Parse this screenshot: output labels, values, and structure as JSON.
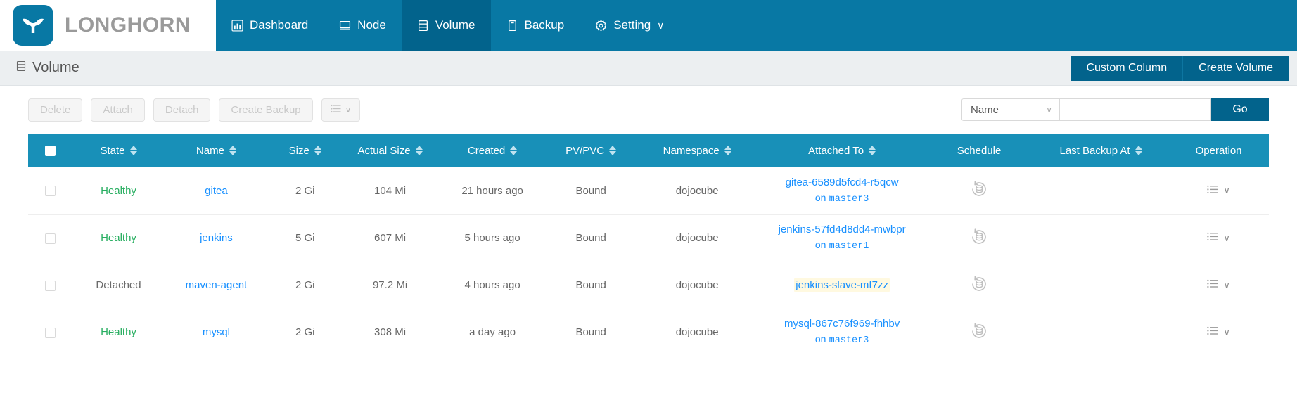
{
  "brand": {
    "name": "LONGHORN",
    "logo_icon": "longhorn-bull-logo"
  },
  "nav": {
    "items": [
      {
        "label": "Dashboard",
        "icon": "chart-bar-icon",
        "active": false
      },
      {
        "label": "Node",
        "icon": "server-node-icon",
        "active": false
      },
      {
        "label": "Volume",
        "icon": "volume-stack-icon",
        "active": true
      },
      {
        "label": "Backup",
        "icon": "backup-archive-icon",
        "active": false
      },
      {
        "label": "Setting",
        "icon": "gear-icon",
        "active": false,
        "caret": "∨"
      }
    ]
  },
  "page": {
    "title": "Volume",
    "title_icon": "volume-stack-icon",
    "actions": [
      {
        "label": "Custom Column"
      },
      {
        "label": "Create Volume"
      }
    ]
  },
  "toolbar": {
    "buttons": [
      {
        "label": "Delete",
        "disabled": true
      },
      {
        "label": "Attach",
        "disabled": true
      },
      {
        "label": "Detach",
        "disabled": true
      },
      {
        "label": "Create Backup",
        "disabled": true
      }
    ],
    "more_button": {
      "icon": "list-bullet-icon",
      "caret": "∨",
      "disabled": true
    },
    "search": {
      "filter_field": "Name",
      "filter_caret": "∨",
      "value": "",
      "placeholder": "",
      "go_label": "Go"
    }
  },
  "table": {
    "columns": [
      {
        "key": "checkbox",
        "label": "",
        "sortable": false
      },
      {
        "key": "state",
        "label": "State",
        "sortable": true
      },
      {
        "key": "name",
        "label": "Name",
        "sortable": true
      },
      {
        "key": "size",
        "label": "Size",
        "sortable": true
      },
      {
        "key": "actual_size",
        "label": "Actual Size",
        "sortable": true
      },
      {
        "key": "created",
        "label": "Created",
        "sortable": true
      },
      {
        "key": "pvpvc",
        "label": "PV/PVC",
        "sortable": true
      },
      {
        "key": "namespace",
        "label": "Namespace",
        "sortable": true
      },
      {
        "key": "attached_to",
        "label": "Attached To",
        "sortable": true
      },
      {
        "key": "schedule",
        "label": "Schedule",
        "sortable": false
      },
      {
        "key": "last_backup_at",
        "label": "Last Backup At",
        "sortable": true
      },
      {
        "key": "operation",
        "label": "Operation",
        "sortable": false
      }
    ],
    "rows": [
      {
        "state": "Healthy",
        "state_kind": "healthy",
        "name": "gitea",
        "size": "2 Gi",
        "actual_size": "104 Mi",
        "created": "21 hours ago",
        "pvpvc": "Bound",
        "namespace": "dojocube",
        "attached_pod": "gitea-6589d5fcd4-r5qcw",
        "attached_on": "on",
        "attached_node": "master3",
        "attached_highlight": false,
        "schedule_icon": "backup-schedule-icon",
        "last_backup_at": "",
        "operation_icon": "list-bullet-icon",
        "operation_caret": "∨"
      },
      {
        "state": "Healthy",
        "state_kind": "healthy",
        "name": "jenkins",
        "size": "5 Gi",
        "actual_size": "607 Mi",
        "created": "5 hours ago",
        "pvpvc": "Bound",
        "namespace": "dojocube",
        "attached_pod": "jenkins-57fd4d8dd4-mwbpr",
        "attached_on": "on",
        "attached_node": "master1",
        "attached_highlight": false,
        "schedule_icon": "backup-schedule-icon",
        "last_backup_at": "",
        "operation_icon": "list-bullet-icon",
        "operation_caret": "∨"
      },
      {
        "state": "Detached",
        "state_kind": "detached",
        "name": "maven-agent",
        "size": "2 Gi",
        "actual_size": "97.2 Mi",
        "created": "4 hours ago",
        "pvpvc": "Bound",
        "namespace": "dojocube",
        "attached_pod": "jenkins-slave-mf7zz",
        "attached_on": "",
        "attached_node": "",
        "attached_highlight": true,
        "schedule_icon": "backup-schedule-icon",
        "last_backup_at": "",
        "operation_icon": "list-bullet-icon",
        "operation_caret": "∨"
      },
      {
        "state": "Healthy",
        "state_kind": "healthy",
        "name": "mysql",
        "size": "2 Gi",
        "actual_size": "308 Mi",
        "created": "a day ago",
        "pvpvc": "Bound",
        "namespace": "dojocube",
        "attached_pod": "mysql-867c76f969-fhhbv",
        "attached_on": "on",
        "attached_node": "master3",
        "attached_highlight": false,
        "schedule_icon": "backup-schedule-icon",
        "last_backup_at": "",
        "operation_icon": "list-bullet-icon",
        "operation_caret": "∨"
      }
    ]
  },
  "colors": {
    "nav_bg": "#0878a4",
    "nav_active_bg": "#02638c",
    "table_header_bg": "#1890b8",
    "link": "#1890ff",
    "healthy": "#27ae60",
    "highlight": "#fff9e0",
    "button_primary": "#02638c"
  }
}
